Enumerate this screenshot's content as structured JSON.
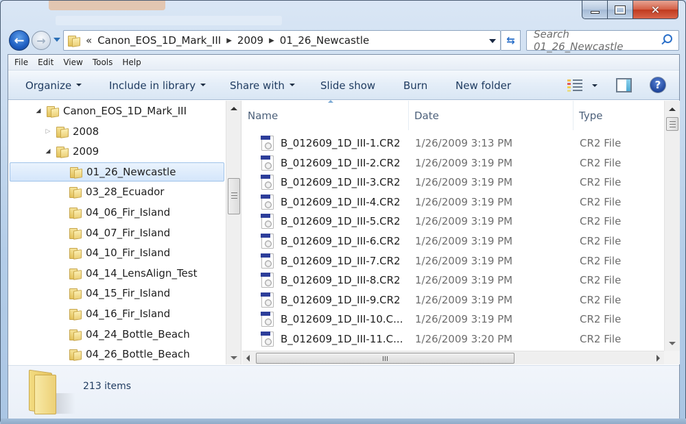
{
  "window": {
    "caption_buttons": {
      "minimize": "minimize",
      "maximize": "maximize",
      "close": "✕"
    }
  },
  "navigation": {
    "back_icon": "←",
    "forward_icon": "→",
    "refresh_icon": "⇆"
  },
  "address_bar": {
    "overflow_chevrons": "«",
    "breadcrumbs": [
      "Canon_EOS_1D_Mark_III",
      "2009",
      "01_26_Newcastle"
    ],
    "separator": "▶"
  },
  "search": {
    "placeholder": "Search 01_26_Newcastle"
  },
  "menu": {
    "items": [
      "File",
      "Edit",
      "View",
      "Tools",
      "Help"
    ]
  },
  "toolbar": {
    "organize": "Organize",
    "include_in_library": "Include in library",
    "share_with": "Share with",
    "slide_show": "Slide show",
    "burn": "Burn",
    "new_folder": "New folder",
    "help_glyph": "?"
  },
  "tree": {
    "expanded_glyph": "◢",
    "collapsed_glyph": "▷",
    "items": [
      {
        "label": "Canon_EOS_1D_Mark_III",
        "level": 0,
        "state": "expanded"
      },
      {
        "label": "2008",
        "level": 1,
        "state": "collapsed"
      },
      {
        "label": "2009",
        "level": 1,
        "state": "expanded"
      },
      {
        "label": "01_26_Newcastle",
        "level": 2,
        "state": "selected"
      },
      {
        "label": "03_28_Ecuador",
        "level": 2,
        "state": "none"
      },
      {
        "label": "04_06_Fir_Island",
        "level": 2,
        "state": "none"
      },
      {
        "label": "04_07_Fir_Island",
        "level": 2,
        "state": "none"
      },
      {
        "label": "04_10_Fir_Island",
        "level": 2,
        "state": "none"
      },
      {
        "label": "04_14_LensAlign_Test",
        "level": 2,
        "state": "none"
      },
      {
        "label": "04_15_Fir_Island",
        "level": 2,
        "state": "none"
      },
      {
        "label": "04_16_Fir_Island",
        "level": 2,
        "state": "none"
      },
      {
        "label": "04_24_Bottle_Beach",
        "level": 2,
        "state": "none"
      },
      {
        "label": "04_26_Bottle_Beach",
        "level": 2,
        "state": "none"
      }
    ]
  },
  "file_list": {
    "columns": [
      "Name",
      "Date",
      "Type"
    ],
    "sorted_by": "Name",
    "rows": [
      {
        "name": "B_012609_1D_III-1.CR2",
        "date": "1/26/2009 3:13 PM",
        "type": "CR2 File"
      },
      {
        "name": "B_012609_1D_III-2.CR2",
        "date": "1/26/2009 3:19 PM",
        "type": "CR2 File"
      },
      {
        "name": "B_012609_1D_III-3.CR2",
        "date": "1/26/2009 3:19 PM",
        "type": "CR2 File"
      },
      {
        "name": "B_012609_1D_III-4.CR2",
        "date": "1/26/2009 3:19 PM",
        "type": "CR2 File"
      },
      {
        "name": "B_012609_1D_III-5.CR2",
        "date": "1/26/2009 3:19 PM",
        "type": "CR2 File"
      },
      {
        "name": "B_012609_1D_III-6.CR2",
        "date": "1/26/2009 3:19 PM",
        "type": "CR2 File"
      },
      {
        "name": "B_012609_1D_III-7.CR2",
        "date": "1/26/2009 3:19 PM",
        "type": "CR2 File"
      },
      {
        "name": "B_012609_1D_III-8.CR2",
        "date": "1/26/2009 3:19 PM",
        "type": "CR2 File"
      },
      {
        "name": "B_012609_1D_III-9.CR2",
        "date": "1/26/2009 3:19 PM",
        "type": "CR2 File"
      },
      {
        "name": "B_012609_1D_III-10.C...",
        "date": "1/26/2009 3:19 PM",
        "type": "CR2 File"
      },
      {
        "name": "B_012609_1D_III-11.C...",
        "date": "1/26/2009 3:20 PM",
        "type": "CR2 File"
      }
    ]
  },
  "details": {
    "item_count": "213 items"
  },
  "colors": {
    "selection_bg": "#d4e6fb",
    "selection_border": "#9fc3ea",
    "header_text": "#4c607a",
    "secondary_text": "#6d6d6d",
    "cr2_badge": "#2d3e9a"
  }
}
